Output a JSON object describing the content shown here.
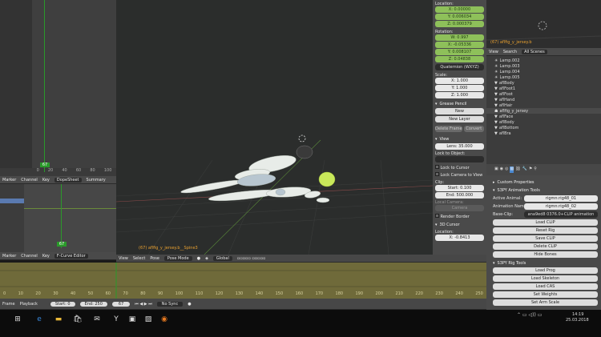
{
  "viewport": {
    "object_label": "(67) aflfig_y_jersey.b__Spine3"
  },
  "left_editor": {
    "header_dopesheet": [
      "Marker",
      "Channel",
      "Key"
    ],
    "dopesheet_mode": "DopeSheet",
    "summary_label": "Summary",
    "header_fcurve": [
      "Marker",
      "Channel",
      "Key"
    ],
    "fcurve_mode": "F-Curve Editor",
    "frame_badge_top": "67",
    "frame_badge_bottom": "67",
    "ruler_numbers": [
      "0",
      "20",
      "40",
      "60",
      "80",
      "100"
    ]
  },
  "view3d_header": {
    "menus": [
      "View",
      "Select",
      "Pose"
    ],
    "mode": "Pose Mode",
    "orientation": "Global"
  },
  "timeline": {
    "menus": [
      "Frame",
      "Playback"
    ],
    "start": "Start: 0",
    "end": "End: 250",
    "current": "67",
    "sync": "No Sync",
    "ruler": [
      "0",
      "10",
      "20",
      "30",
      "40",
      "50",
      "60",
      "70",
      "80",
      "90",
      "100",
      "110",
      "120",
      "130",
      "140",
      "150",
      "160",
      "170",
      "180",
      "190",
      "200",
      "210",
      "220",
      "230",
      "240",
      "250"
    ]
  },
  "npanel": {
    "location_label": "Location:",
    "location": [
      "X: 0.00000",
      "Y: 0.006034",
      "Z: 0.000379"
    ],
    "rotation_label": "Rotation:",
    "rotation": [
      "W: 0.997",
      "X: -0.05336",
      "Y: 0.008107",
      "Z: 0.04838"
    ],
    "rotation_mode": "Quaternion (WXYZ)",
    "scale_label": "Scale:",
    "scale": [
      "X: 1.000",
      "Y: 1.000",
      "Z: 1.000"
    ],
    "grease_title": "Grease Pencil",
    "grease_new": "New",
    "grease_newlayer": "New Layer",
    "grease_delete": "Delete Frame",
    "grease_convert": "Convert",
    "view_title": "View",
    "lens": "Lens: 35.000",
    "lock_obj": "Lock to Object:",
    "lock_cursor": "Lock to Cursor",
    "lock_camera": "Lock Camera to View",
    "clip_label": "Clip:",
    "clip_start": "Start: 0.100",
    "clip_end": "End: 500.000",
    "local_camera": "Local Camera:",
    "camera_field": "Camera",
    "render_border": "Render Border",
    "cursor_title": "3D Cursor",
    "cursor_location": "Location:",
    "cursor_x": "X: -0.8413"
  },
  "outliner": {
    "header_label": "(67) aflfig_y_jersey.b",
    "tabs": [
      "View",
      "Search",
      "All Scenes"
    ],
    "rows": [
      "Lamp.002",
      "Lamp.003",
      "Lamp.004",
      "Lamp.005",
      "aflBody",
      "aflFoot1",
      "aflFoot",
      "aflHand",
      "aflHair",
      "aflfig_y_jersey",
      "aflFace",
      "aflBody",
      "aflBottom",
      "aflBra"
    ]
  },
  "props": {
    "custom_props": "Custom Properties",
    "anim_title": "S3PY Animation Tools",
    "active_animal_label": "Active Animal:",
    "active_animal": "rigmn:rig48_01",
    "anim_name_label": "Animation Nam:",
    "anim_name": "rigmn:rig48_02",
    "base_clip_label": "Base-Clip:",
    "base_clip": "ana9ed8 0376.0+CLIP animation",
    "buttons1": [
      "Load CLIP",
      "Reset Rig",
      "Save CLIP",
      "Delete CLIP",
      "Hide Bones"
    ],
    "rig_title": "S3PY Rig Tools",
    "buttons2": [
      "Load Prog",
      "Load Skeleton",
      "Load CAS",
      "Set Weights",
      "Set Arm Scale"
    ]
  },
  "taskbar": {
    "time": "14:19",
    "date": "25.03.2018",
    "icons": [
      "windows-icon",
      "search-icon",
      "task-view-icon",
      "edge-icon",
      "explorer-icon",
      "store-icon",
      "mail-icon",
      "yandex-icon",
      "photos-icon",
      "image-icon",
      "blender-icon"
    ]
  },
  "colors": {
    "accent_green": "#8ec05a",
    "keyframe": "#e8a030",
    "timeline_bg": "#6f6a3a",
    "selected": "#4a88d0"
  }
}
